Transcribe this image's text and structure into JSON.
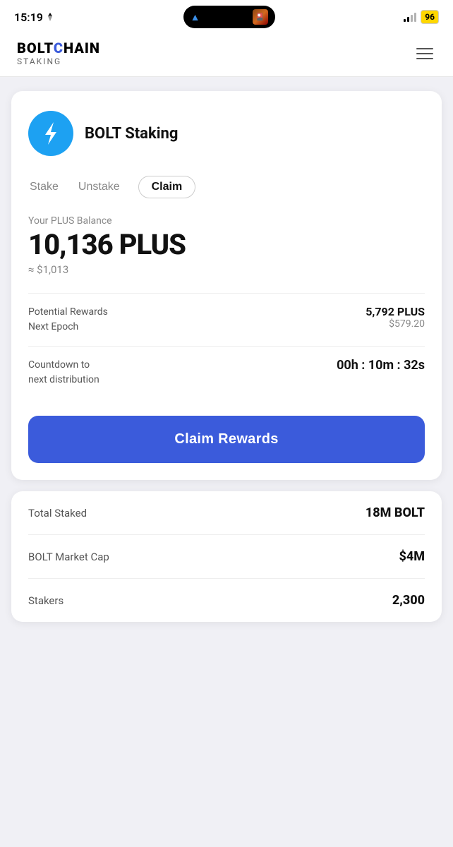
{
  "statusBar": {
    "time": "15:19",
    "batteryLevel": "96"
  },
  "header": {
    "brandName": "BOLTCHAIN",
    "brandSub": "Staking",
    "menuLabel": "menu"
  },
  "card": {
    "logoAlt": "BOLT token logo",
    "title": "BOLT Staking",
    "tabs": [
      {
        "label": "Stake",
        "active": false
      },
      {
        "label": "Unstake",
        "active": false
      },
      {
        "label": "Claim",
        "active": true
      }
    ],
    "balance": {
      "label": "Your PLUS Balance",
      "amount": "10,136 PLUS",
      "usd": "≈ $1,013"
    },
    "rewards": {
      "label1": "Potential Rewards",
      "label2": "Next Epoch",
      "valuePlus": "5,792 PLUS",
      "valueUsd": "$579.20"
    },
    "countdown": {
      "label1": "Countdown to",
      "label2": "next distribution",
      "value": "00h : 10m : 32s"
    },
    "claimButton": "Claim Rewards"
  },
  "stats": [
    {
      "label": "Total Staked",
      "value": "18M BOLT"
    },
    {
      "label": "BOLT Market Cap",
      "value": "$4M"
    },
    {
      "label": "Stakers",
      "value": "2,300"
    }
  ]
}
